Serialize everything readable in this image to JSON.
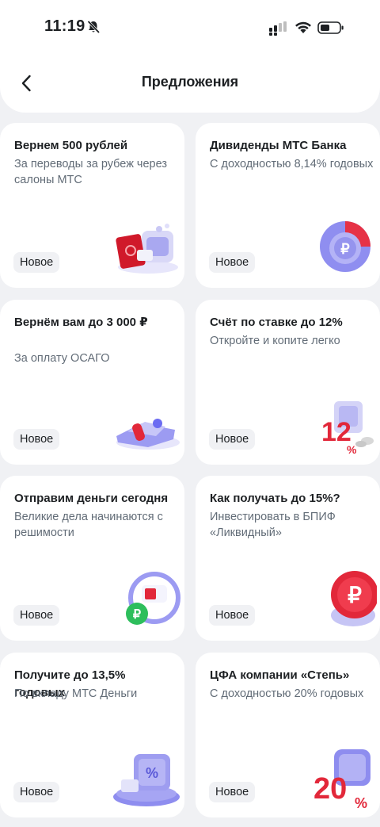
{
  "status": {
    "time": "11:19"
  },
  "header": {
    "title": "Предложения"
  },
  "badge_label": "Новое",
  "offers": [
    {
      "title": "Вернем 500 рублей",
      "subtitle": "За переводы за рубеж через салоны МТС",
      "badge": "Новое",
      "illustration": "passport-travel-icon"
    },
    {
      "title": "Дивиденды МТС Банка",
      "subtitle": "С доходностью 8,14% годовых",
      "badge": "Новое",
      "illustration": "ruble-coin-chart-icon"
    },
    {
      "title": "Вернём вам до 3 000 ₽",
      "subtitle": "За оплату ОСАГО",
      "badge": "Новое",
      "illustration": "car-key-icon"
    },
    {
      "title": "Счёт по ставке до 12%",
      "subtitle": "Откройте и копите легко",
      "badge": "Новое",
      "illustration": "percent-safe-icon"
    },
    {
      "title": "Отправим деньги сегодня",
      "subtitle": "Великие дела начинаются с решимости",
      "badge": "Новое",
      "illustration": "money-transfer-icon"
    },
    {
      "title": "Как получать до 15%?",
      "subtitle": "Инвестировать в БПИФ «Ликвидный»",
      "badge": "Новое",
      "illustration": "ruble-coin-icon"
    },
    {
      "title": "Получите до 13,5% годовых",
      "subtitle": "По вкладу МТС Деньги",
      "badge": "Новое",
      "illustration": "vault-percent-icon"
    },
    {
      "title": "ЦФА компании «Степь»",
      "subtitle": "С доходностью 20% годовых",
      "badge": "Новое",
      "illustration": "twenty-percent-icon"
    }
  ],
  "colors": {
    "page_bg": "#F0F1F4",
    "card_bg": "#FFFFFF",
    "text_primary": "#1D2023",
    "text_secondary": "#626C77",
    "accent_red": "#E30611",
    "accent_violet": "#6C6CF2"
  }
}
